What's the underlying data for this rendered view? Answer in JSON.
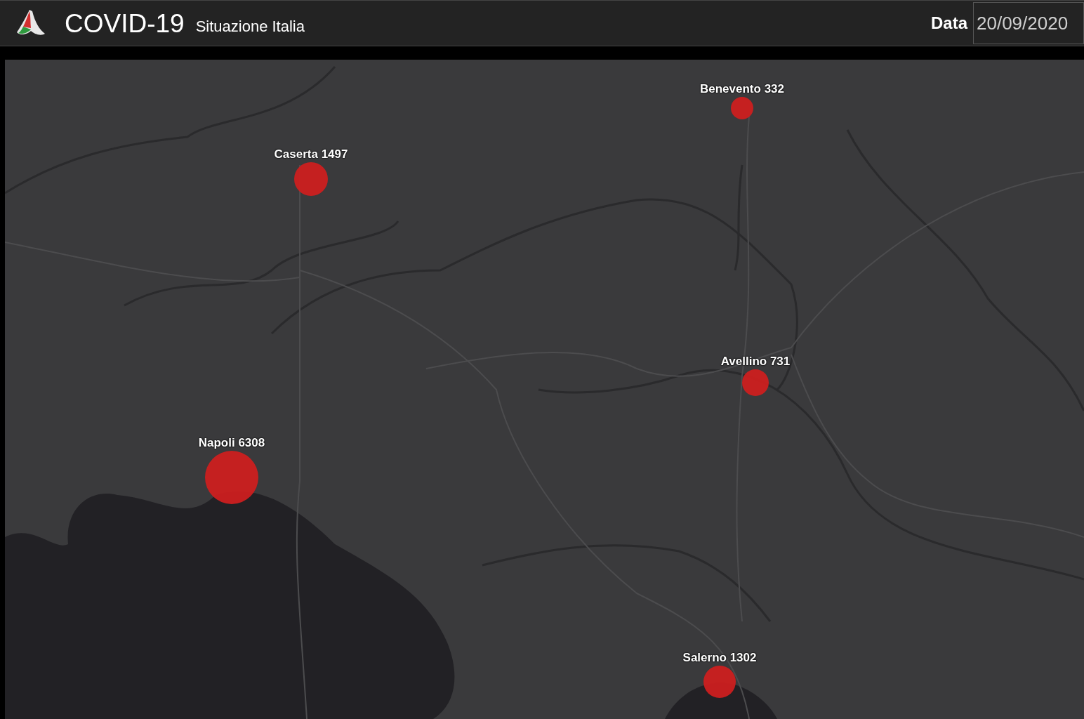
{
  "header": {
    "title": "COVID-19",
    "subtitle": "Situazione Italia",
    "date_label": "Data",
    "date_value": "20/09/2020"
  },
  "map": {
    "markers": [
      {
        "name": "Benevento",
        "count": "332"
      },
      {
        "name": "Caserta",
        "count": "1497"
      },
      {
        "name": "Avellino",
        "count": "731"
      },
      {
        "name": "Napoli",
        "count": "6308"
      },
      {
        "name": "Salerno",
        "count": "1302"
      }
    ]
  }
}
